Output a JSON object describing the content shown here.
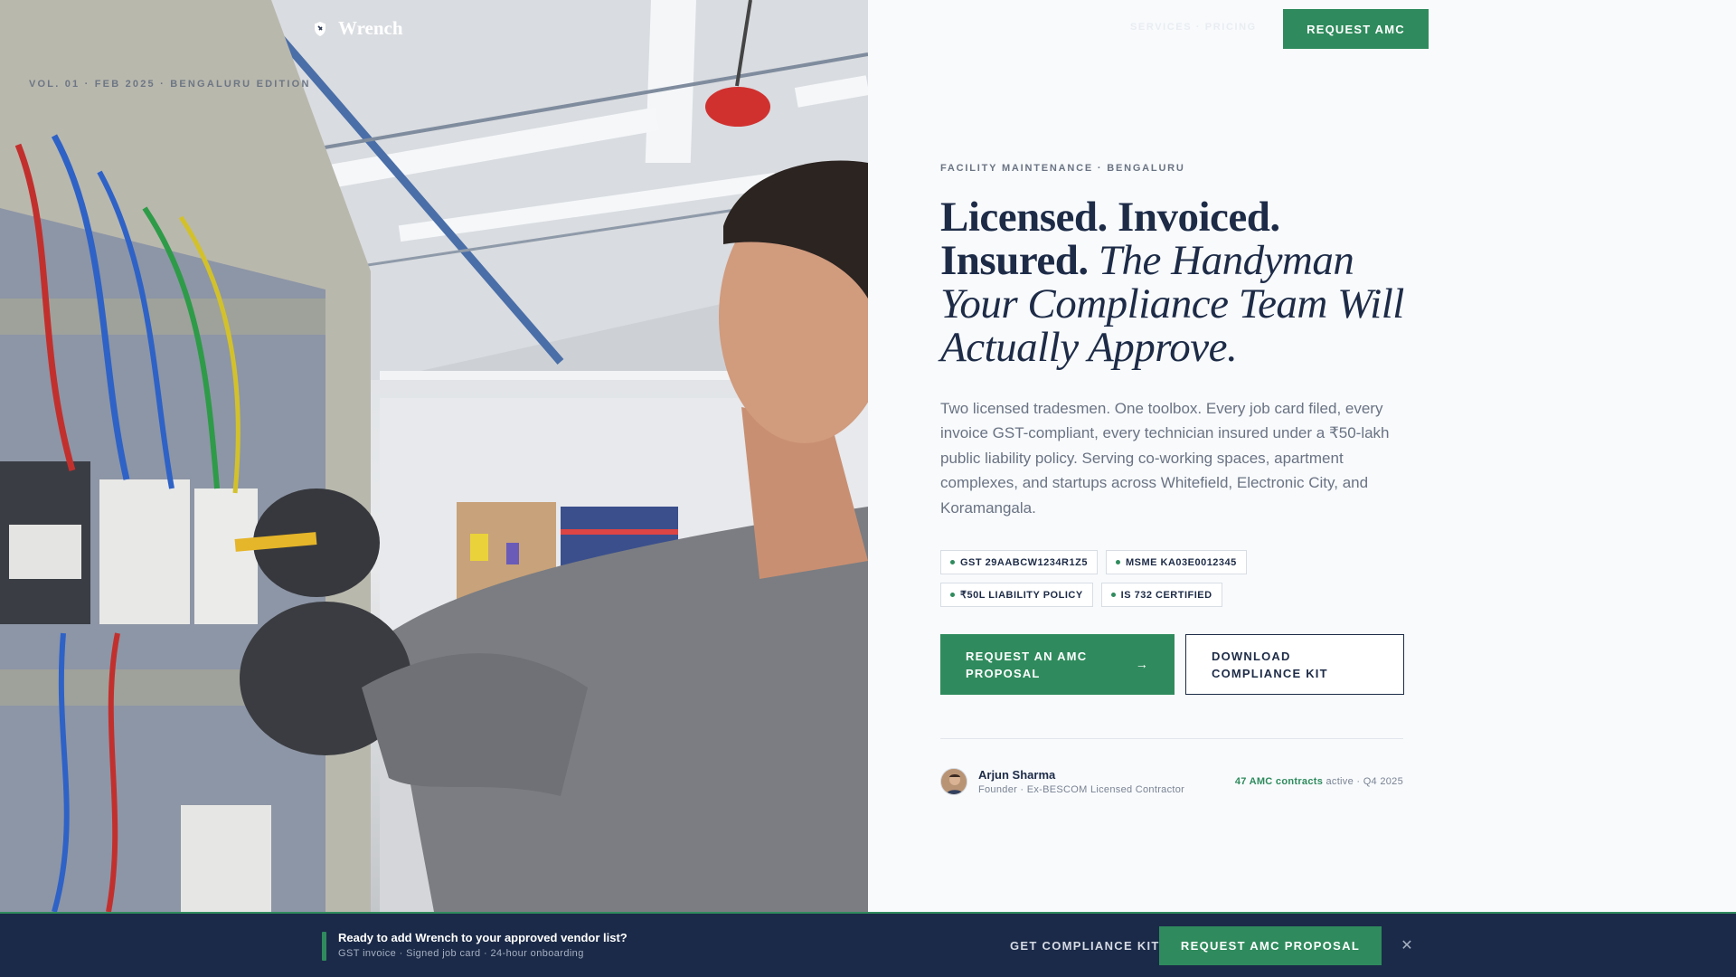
{
  "brand": {
    "name": "Wrench",
    "logo_icon": "wrench-shield-icon"
  },
  "photo": {
    "alt": "Technician in gray uniform and black gloves working on an electrical panel in a warehouse",
    "vol_tag": "VOL. 01 · FEB 2025 · BENGALURU EDITION"
  },
  "nav": {
    "faded_link": "SERVICES · PRICING",
    "request_amc_label": "REQUEST AMC"
  },
  "hero": {
    "eyebrow": "FACILITY MAINTENANCE · BENGALURU",
    "headline_strong_1": "Licensed. Invoiced.",
    "headline_strong_2": "Insured.",
    "headline_italic": "The Handyman Your Compliance Team Will Actually Approve.",
    "lede": "Two licensed tradesmen. One toolbox. Every job card filed, every invoice GST-compliant, every technician insured under a ₹50-lakh public liability policy. Serving co-working spaces, apartment complexes, and startups across Whitefield, Electronic City, and Koramangala.",
    "badges": [
      "GST 29AABCW1234R1Z5",
      "MSME KA03E0012345",
      "₹50L LIABILITY POLICY",
      "IS 732 CERTIFIED"
    ],
    "cta_primary": "REQUEST AN AMC PROPOSAL",
    "cta_primary_icon": "arrow-right-icon",
    "cta_secondary": "DOWNLOAD COMPLIANCE KIT"
  },
  "founder": {
    "name": "Arjun Sharma",
    "role": "Founder · Ex-BESCOM Licensed Contractor",
    "stat_highlight": "47 AMC contracts",
    "stat_rest": " active · Q4 2025"
  },
  "sticky_bar": {
    "title": "Ready to add Wrench to your approved vendor list?",
    "subtitle": "GST invoice · Signed job card · 24-hour onboarding",
    "link_label": "GET COMPLIANCE KIT",
    "button_label": "REQUEST AMC PROPOSAL",
    "close_icon": "close-icon"
  },
  "colors": {
    "accent": "#2f8b5d",
    "navy": "#1b2a48",
    "text": "#1d2b47",
    "muted": "#6a7383",
    "background": "#f8fafc"
  }
}
